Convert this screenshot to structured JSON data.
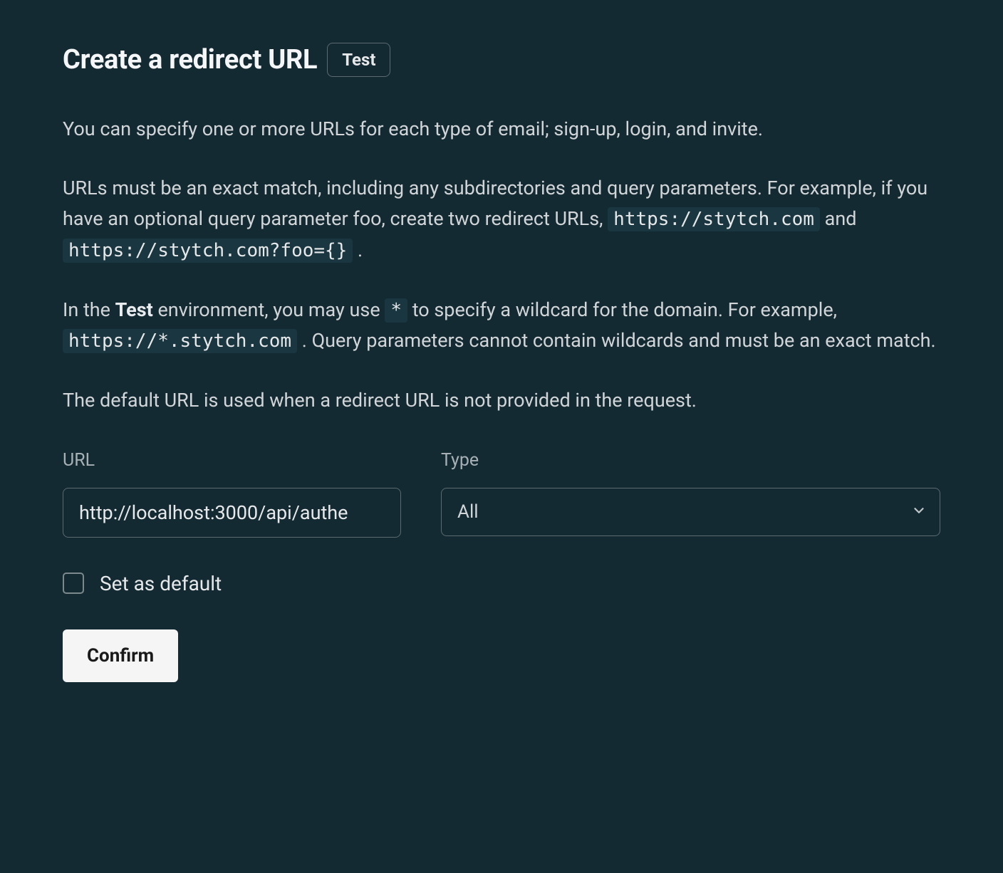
{
  "header": {
    "title": "Create a redirect URL",
    "env_badge": "Test"
  },
  "descriptions": {
    "p1": "You can specify one or more URLs for each type of email; sign-up, login, and invite.",
    "p2_prefix": "URLs must be an exact match, including any subdirectories and query parameters. For example, if you have an optional query parameter foo, create two redirect URLs, ",
    "p2_code1": "https://stytch.com",
    "p2_and": " and ",
    "p2_code2": "https://stytch.com?foo={}",
    "p2_suffix": " .",
    "p3_prefix": "In the ",
    "p3_env": "Test",
    "p3_mid1": " environment, you may use ",
    "p3_wildcard": "*",
    "p3_mid2": " to specify a wildcard for the domain. For example, ",
    "p3_code": "https://*.stytch.com",
    "p3_suffix": ". Query parameters cannot contain wildcards and must be an exact match.",
    "p4": "The default URL is used when a redirect URL is not provided in the request."
  },
  "form": {
    "url_label": "URL",
    "url_value": "http://localhost:3000/api/authe",
    "type_label": "Type",
    "type_selected": "All",
    "set_default_label": "Set as default",
    "confirm_label": "Confirm"
  }
}
